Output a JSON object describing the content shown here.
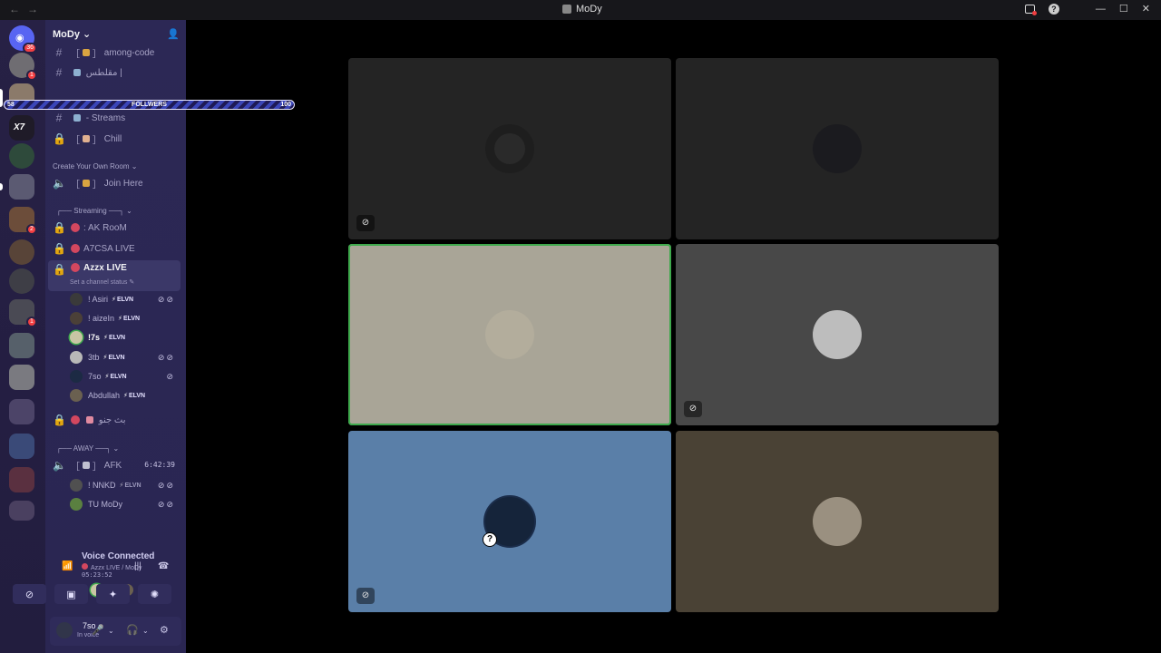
{
  "titlebar": {
    "title": "MoDy",
    "back": "←",
    "forward": "→",
    "minimize": "—",
    "maximize": "☐",
    "close": "✕"
  },
  "server": {
    "name": "MoDy ⌄"
  },
  "guild_badges": {
    "home": "36",
    "g1": "1",
    "g10": "2",
    "g14": "1"
  },
  "follower_bar": {
    "current": "58",
    "label": "FOLLWERS",
    "goal": "100",
    "progress": 0.58
  },
  "channels": {
    "among": "among-code",
    "arabic1": "مقلطس |",
    "streams": "- Streams",
    "chill": "Chill",
    "cat_create": "Create Your Own Room ⌄",
    "join": "Join Here",
    "cat_streaming": "┌── Streaming ──┐ ⌄",
    "ak": ": AK RooM",
    "a7csa": "A7CSA LIVE",
    "azzx": "Azzx LIVE",
    "azzx_status": "Set a channel status ✎",
    "arabic2": "بث جنو",
    "cat_away": "┌── AWAY ──┐ ⌄",
    "afk": "AFK",
    "afk_timer": "6:42:39"
  },
  "voice_users": [
    {
      "name": "! Asiri",
      "tag": "ELVN",
      "icons": "⊘⊘"
    },
    {
      "name": "! aizeIn",
      "tag": "ELVN",
      "icons": ""
    },
    {
      "name": "!7s",
      "tag": "ELVN",
      "icons": ""
    },
    {
      "name": "3tb",
      "tag": "ELVN",
      "icons": "⊘⊘"
    },
    {
      "name": "7so",
      "tag": "ELVN",
      "icons": "⊘"
    },
    {
      "name": "Abdullah",
      "tag": "ELVN",
      "icons": ""
    }
  ],
  "afk_users": [
    {
      "name": "! NNKD",
      "tag": "ELVN",
      "icons": "⊘⊘"
    },
    {
      "name": "TU MoDy",
      "tag": "",
      "icons": "⊘⊘"
    }
  ],
  "voice_panel": {
    "title": "Voice Connected",
    "channel": "Azzx LIVE / MoDy",
    "elapsed": "05:23:52"
  },
  "user": {
    "name": "7so",
    "status": "In voice"
  },
  "colors": {
    "speaking": "#3ea94c",
    "accent": "#3a45b8",
    "live": "#d3475f"
  }
}
